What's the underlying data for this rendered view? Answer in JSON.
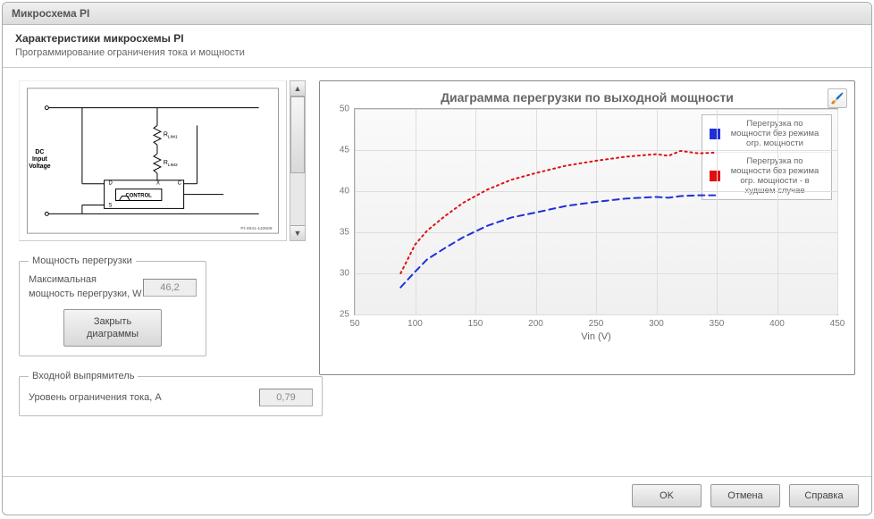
{
  "window": {
    "title": "Микросхема PI"
  },
  "subheader": {
    "title": "Характеристики микросхемы PI",
    "desc": "Программирование ограничения тока и мощности"
  },
  "schematic": {
    "labels": {
      "rlim1": "R",
      "rlim1_sub": "LIM1",
      "rlim2": "R",
      "rlim2_sub": "LIM2",
      "dc_v": "DC\nInput\nVoltage",
      "control": "CONTROL",
      "pins": {
        "d": "D",
        "c": "C",
        "x": "X",
        "s": "S"
      },
      "part": "PI-4941-110609"
    }
  },
  "overload": {
    "legend": "Мощность перегрузки",
    "max_label": "Максимальная мощность перегрузки, W",
    "max_value": "46,2",
    "close_btn": "Закрыть\nдиаграммы"
  },
  "rectifier": {
    "legend": "Входной выпрямитель",
    "limit_label": "Уровень ограничения тока, A",
    "limit_value": "0,79"
  },
  "chart": {
    "title": "Диаграмма перегрузки по выходной мощности",
    "xlabel": "Vin (V)",
    "legend1": "Перегрузка по мощности без режима огр. мощности",
    "legend2": "Перегрузка по мощности без режима огр. мощности - в худшем случае",
    "color1": "#2030d8",
    "color2": "#e01010"
  },
  "chart_data": {
    "type": "line",
    "title": "Диаграмма перегрузки по выходной мощности",
    "xlabel": "Vin (V)",
    "ylabel": "",
    "xlim": [
      50,
      450
    ],
    "ylim": [
      25,
      50
    ],
    "xticks": [
      50,
      100,
      150,
      200,
      250,
      300,
      350,
      400,
      450
    ],
    "yticks": [
      25,
      30,
      35,
      40,
      45,
      50
    ],
    "series": [
      {
        "name": "Перегрузка по мощности без режима огр. мощности",
        "color": "#2030d8",
        "style": "dashed",
        "x": [
          88,
          100,
          110,
          125,
          140,
          160,
          180,
          200,
          225,
          250,
          275,
          300,
          310,
          320,
          335,
          350
        ],
        "y": [
          28.3,
          30.2,
          31.7,
          33.1,
          34.4,
          35.8,
          36.8,
          37.4,
          38.2,
          38.7,
          39.1,
          39.3,
          39.2,
          39.4,
          39.5,
          39.5
        ]
      },
      {
        "name": "Перегрузка по мощности без режима огр. мощности - в худшем случае",
        "color": "#e01010",
        "style": "dotted",
        "x": [
          88,
          100,
          110,
          125,
          140,
          160,
          180,
          200,
          225,
          250,
          275,
          300,
          310,
          320,
          335,
          350
        ],
        "y": [
          30.0,
          33.5,
          35.2,
          37.0,
          38.6,
          40.2,
          41.4,
          42.2,
          43.1,
          43.7,
          44.2,
          44.5,
          44.3,
          44.9,
          44.6,
          44.7
        ]
      }
    ]
  },
  "footer": {
    "ok": "OK",
    "cancel": "Отмена",
    "help": "Справка"
  }
}
